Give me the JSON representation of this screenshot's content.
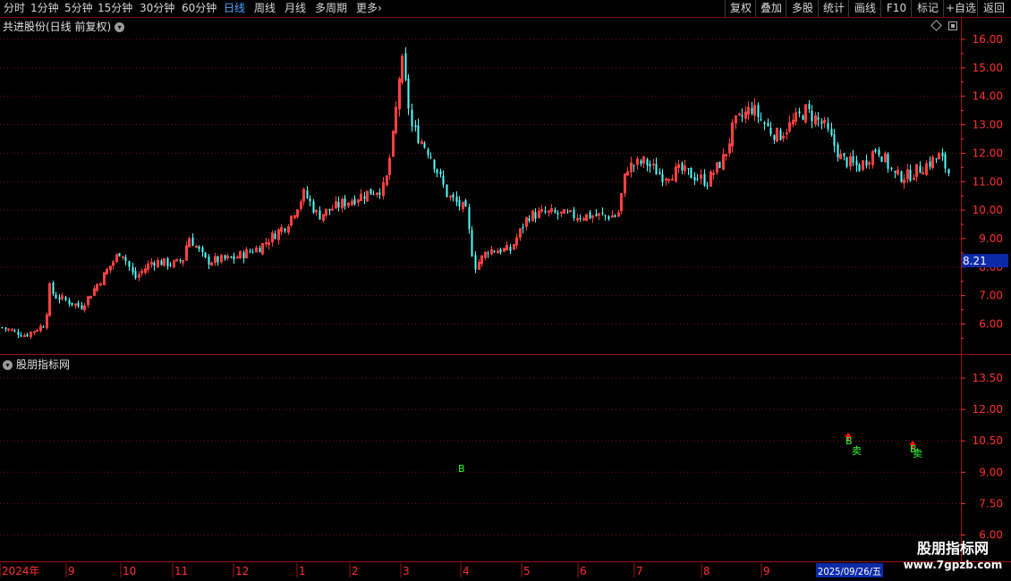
{
  "toolbar": {
    "timeframes": [
      {
        "label": "分时"
      },
      {
        "label": "1分钟"
      },
      {
        "label": "5分钟"
      },
      {
        "label": "15分钟"
      },
      {
        "label": "30分钟"
      },
      {
        "label": "60分钟"
      },
      {
        "label": "日线"
      },
      {
        "label": "周线"
      },
      {
        "label": "月线"
      },
      {
        "label": "多周期"
      },
      {
        "label": "更多"
      }
    ],
    "more_arrow": "›",
    "right_buttons": [
      {
        "label": "复权"
      },
      {
        "label": "叠加"
      },
      {
        "label": "多股"
      },
      {
        "label": "统计"
      },
      {
        "label": "画线"
      },
      {
        "label": "F10"
      },
      {
        "label": "标记"
      },
      {
        "label": "+自选"
      },
      {
        "label": "返回"
      }
    ]
  },
  "main_chart": {
    "title": "共进股份(日线 前复权)",
    "price_axis": [
      "16.00",
      "15.00",
      "14.00",
      "13.00",
      "12.00",
      "11.00",
      "10.00",
      "9.00",
      "8.00",
      "7.00",
      "6.00"
    ],
    "current_price_label": "8.21"
  },
  "sub_chart": {
    "title": "股朋指标网",
    "axis": [
      "13.50",
      "12.00",
      "10.50",
      "9.00",
      "7.50",
      "6.00"
    ],
    "signals": [
      "B",
      "B",
      "卖",
      "B",
      "卖"
    ]
  },
  "time_axis": {
    "labels": [
      "2024年",
      "9",
      "10",
      "11",
      "12",
      "1",
      "2",
      "3",
      "4",
      "5",
      "6",
      "7",
      "8",
      "9"
    ],
    "cursor_date": "2025/09/26/五"
  },
  "watermark": {
    "name": "股朋指标网",
    "url": "www.7gpzb.com"
  },
  "colors": {
    "up": "#ff4040",
    "down": "#54ffff",
    "grid": "#7a1010",
    "axis_text": "#ff3030",
    "signal_green": "#33ff33",
    "signal_red": "#ff1010",
    "cursor_bg": "#0a2aa8"
  },
  "chart_data": {
    "type": "candlestick",
    "price_range": [
      5.4,
      16.2
    ],
    "path_x": [
      0,
      28,
      50,
      55,
      60,
      90,
      100,
      135,
      150,
      170,
      195,
      205,
      210,
      230,
      260,
      290,
      320,
      340,
      355,
      380,
      410,
      430,
      440,
      448,
      460,
      480,
      500,
      520,
      530,
      545,
      570,
      590,
      610,
      640,
      660,
      690,
      700,
      720,
      740,
      760,
      790,
      810,
      820,
      840,
      860,
      870,
      900,
      920,
      940,
      960,
      980,
      1000,
      1015,
      1030,
      1050,
      1062
    ],
    "path_close": [
      5.9,
      5.6,
      6.0,
      7.3,
      7.0,
      6.6,
      7.0,
      8.6,
      7.6,
      8.2,
      8.1,
      8.3,
      9.1,
      8.2,
      8.3,
      8.7,
      9.5,
      10.6,
      9.8,
      10.2,
      10.6,
      10.8,
      12.8,
      15.4,
      12.9,
      12.0,
      10.5,
      10.0,
      8.0,
      8.6,
      8.6,
      9.8,
      9.9,
      9.8,
      9.8,
      9.8,
      11.5,
      11.7,
      11.2,
      11.4,
      11.0,
      11.9,
      13.0,
      13.6,
      12.8,
      12.6,
      13.5,
      13.0,
      11.8,
      11.5,
      12.2,
      11.2,
      11.2,
      11.5,
      11.9,
      11.2
    ],
    "signals": [
      {
        "label": "B",
        "date_index_x": 512
      },
      {
        "label": "B",
        "date_index_x": 945
      },
      {
        "label": "卖",
        "date_index_x": 952
      },
      {
        "label": "B",
        "date_index_x": 1017
      },
      {
        "label": "卖",
        "date_index_x": 1020
      }
    ]
  }
}
